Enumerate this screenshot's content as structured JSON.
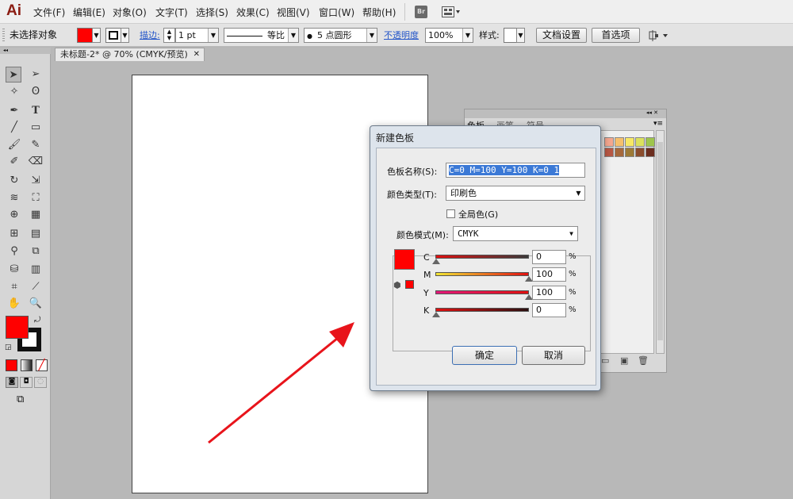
{
  "app": {
    "logo": "Ai"
  },
  "menu": {
    "items": [
      "文件(F)",
      "编辑(E)",
      "对象(O)",
      "文字(T)",
      "选择(S)",
      "效果(C)",
      "视图(V)",
      "窗口(W)",
      "帮助(H)"
    ],
    "bridge_label": "Br"
  },
  "control_bar": {
    "selection_status": "未选择对象",
    "stroke_label": "描边:",
    "stroke_weight": "1 pt",
    "profile_label": "等比",
    "brush_label": "5 点圆形",
    "opacity_label": "不透明度",
    "opacity_value": "100%",
    "style_label": "样式:",
    "doc_setup_button": "文档设置",
    "preferences_button": "首选项",
    "fill_color": "#ff0000"
  },
  "document": {
    "tab_title": "未标题-2* @ 70% (CMYK/预览)"
  },
  "swatches_panel": {
    "tabs": [
      "色板",
      "画笔",
      "符号"
    ],
    "colors": [
      "#f6a78f",
      "#f6c06c",
      "#f7e866",
      "#dbe15e",
      "#9ec54c",
      "#b85844",
      "#a6683b",
      "#9d7a36",
      "#8b4d2d",
      "#6c2e1f"
    ]
  },
  "dialog": {
    "title": "新建色板",
    "swatch_name_label": "色板名称(S):",
    "swatch_name_value": "C=0 M=100 Y=100 K=0 1",
    "color_type_label": "颜色类型(T):",
    "color_type_value": "印刷色",
    "global_label": "全局色(G)",
    "color_mode_label": "颜色模式(M):",
    "color_mode_value": "CMYK",
    "preview_color": "#ff0000",
    "channels": [
      {
        "name": "C",
        "value": "0",
        "unit": "%"
      },
      {
        "name": "M",
        "value": "100",
        "unit": "%"
      },
      {
        "name": "Y",
        "value": "100",
        "unit": "%"
      },
      {
        "name": "K",
        "value": "0",
        "unit": "%"
      }
    ],
    "ok_button": "确定",
    "cancel_button": "取消"
  }
}
